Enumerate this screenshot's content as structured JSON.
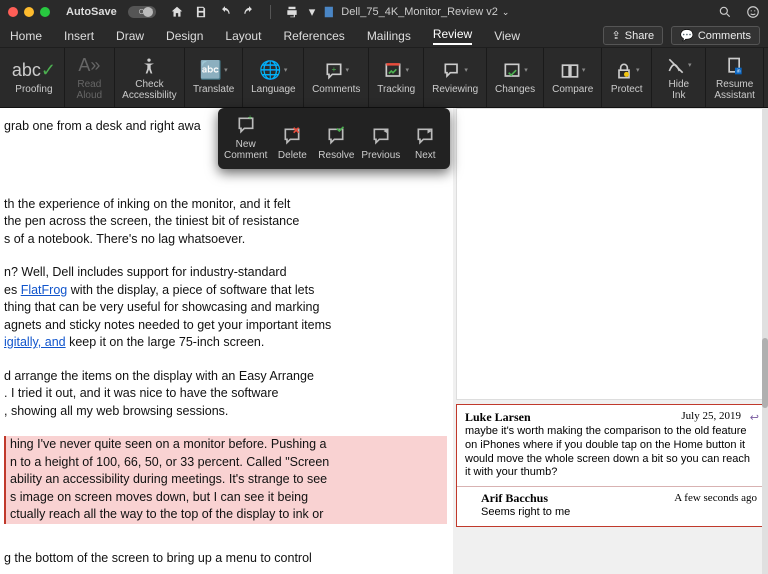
{
  "titlebar": {
    "autosave_label": "AutoSave",
    "autosave_state": "OFF",
    "doc_title": "Dell_75_4K_Monitor_Review v2",
    "icons": {
      "home": "home-icon",
      "save": "save-icon",
      "undo": "undo-icon",
      "redo": "redo-icon",
      "print": "print-icon"
    }
  },
  "tabs": {
    "items": [
      "Home",
      "Insert",
      "Draw",
      "Design",
      "Layout",
      "References",
      "Mailings",
      "Review",
      "View"
    ],
    "active": "Review",
    "share": "Share",
    "comments": "Comments"
  },
  "ribbon": {
    "groups": [
      {
        "label": "Proofing",
        "icon": "abc-check-icon",
        "two_line": false
      },
      {
        "label": "Read\nAloud",
        "icon": "read-aloud-icon",
        "disabled": true
      },
      {
        "label": "Check\nAccessibility",
        "icon": "accessibility-icon"
      },
      {
        "label": "Translate",
        "icon": "translate-icon"
      },
      {
        "label": "Language",
        "icon": "language-icon"
      },
      {
        "label": "Comments",
        "icon": "new-comment-icon"
      },
      {
        "label": "Tracking",
        "icon": "tracking-icon"
      },
      {
        "label": "Reviewing",
        "icon": "reviewing-icon"
      },
      {
        "label": "Changes",
        "icon": "changes-icon"
      },
      {
        "label": "Compare",
        "icon": "compare-icon"
      },
      {
        "label": "Protect",
        "icon": "protect-icon"
      },
      {
        "label": "Hide Ink",
        "icon": "hide-ink-icon"
      },
      {
        "label": "Resume\nAssistant",
        "icon": "resume-assistant-icon"
      }
    ]
  },
  "dropdown": {
    "items": [
      {
        "label": "New\nComment",
        "icon": "new-comment-icon"
      },
      {
        "label": "Delete",
        "icon": "delete-comment-icon"
      },
      {
        "label": "Resolve",
        "icon": "resolve-comment-icon"
      },
      {
        "label": "Previous",
        "icon": "previous-comment-icon"
      },
      {
        "label": "Next",
        "icon": "next-comment-icon"
      }
    ]
  },
  "document": {
    "para1": "grab one from a desk and right awa",
    "para2_l1": "th the experience of inking on the monitor, and it felt",
    "para2_l2": "the pen across the screen, the tiniest bit of resistance",
    "para2_l3": "s of a notebook. There's no lag whatsoever.",
    "para3_l1": "n? Well, Dell includes support for industry-standard",
    "para3_l2a": "es ",
    "para3_link1": "FlatFrog",
    "para3_l2b": " with the display, a piece of software that lets",
    "para3_l3": "thing that can be very useful for showcasing and marking",
    "para3_l4": "agnets and sticky notes needed to get your important items",
    "para3_link2": "igitally, and",
    "para3_l5b": " keep it on the large 75-inch screen.",
    "para4_l1": "d arrange the items on the display with an Easy Arrange",
    "para4_l2": ". I tried it out, and it was nice to have the software",
    "para4_l3": ", showing all my web browsing sessions.",
    "hl_l1": "hing I've never quite seen on a monitor before. Pushing a",
    "hl_l2": "n to a height of 100, 66, 50, or 33 percent. Called \"Screen",
    "hl_l3": "ability an accessibility during meetings. It's strange to see",
    "hl_l4": "s image on screen moves down, but I can see it being",
    "hl_l5": "ctually reach all the way to the top of the display to ink or",
    "para6": "g the bottom of the screen to bring up a menu to control"
  },
  "comments": {
    "thread": {
      "author": "Luke Larsen",
      "time": "July 25, 2019",
      "body": "maybe it's worth making the comparison to the old feature on iPhones where if you double tap on the Home button it would move the whole screen down a bit so you can reach it with your thumb?"
    },
    "reply": {
      "author": "Arif Bacchus",
      "time": "A few seconds ago",
      "body": "Seems right to me"
    }
  }
}
